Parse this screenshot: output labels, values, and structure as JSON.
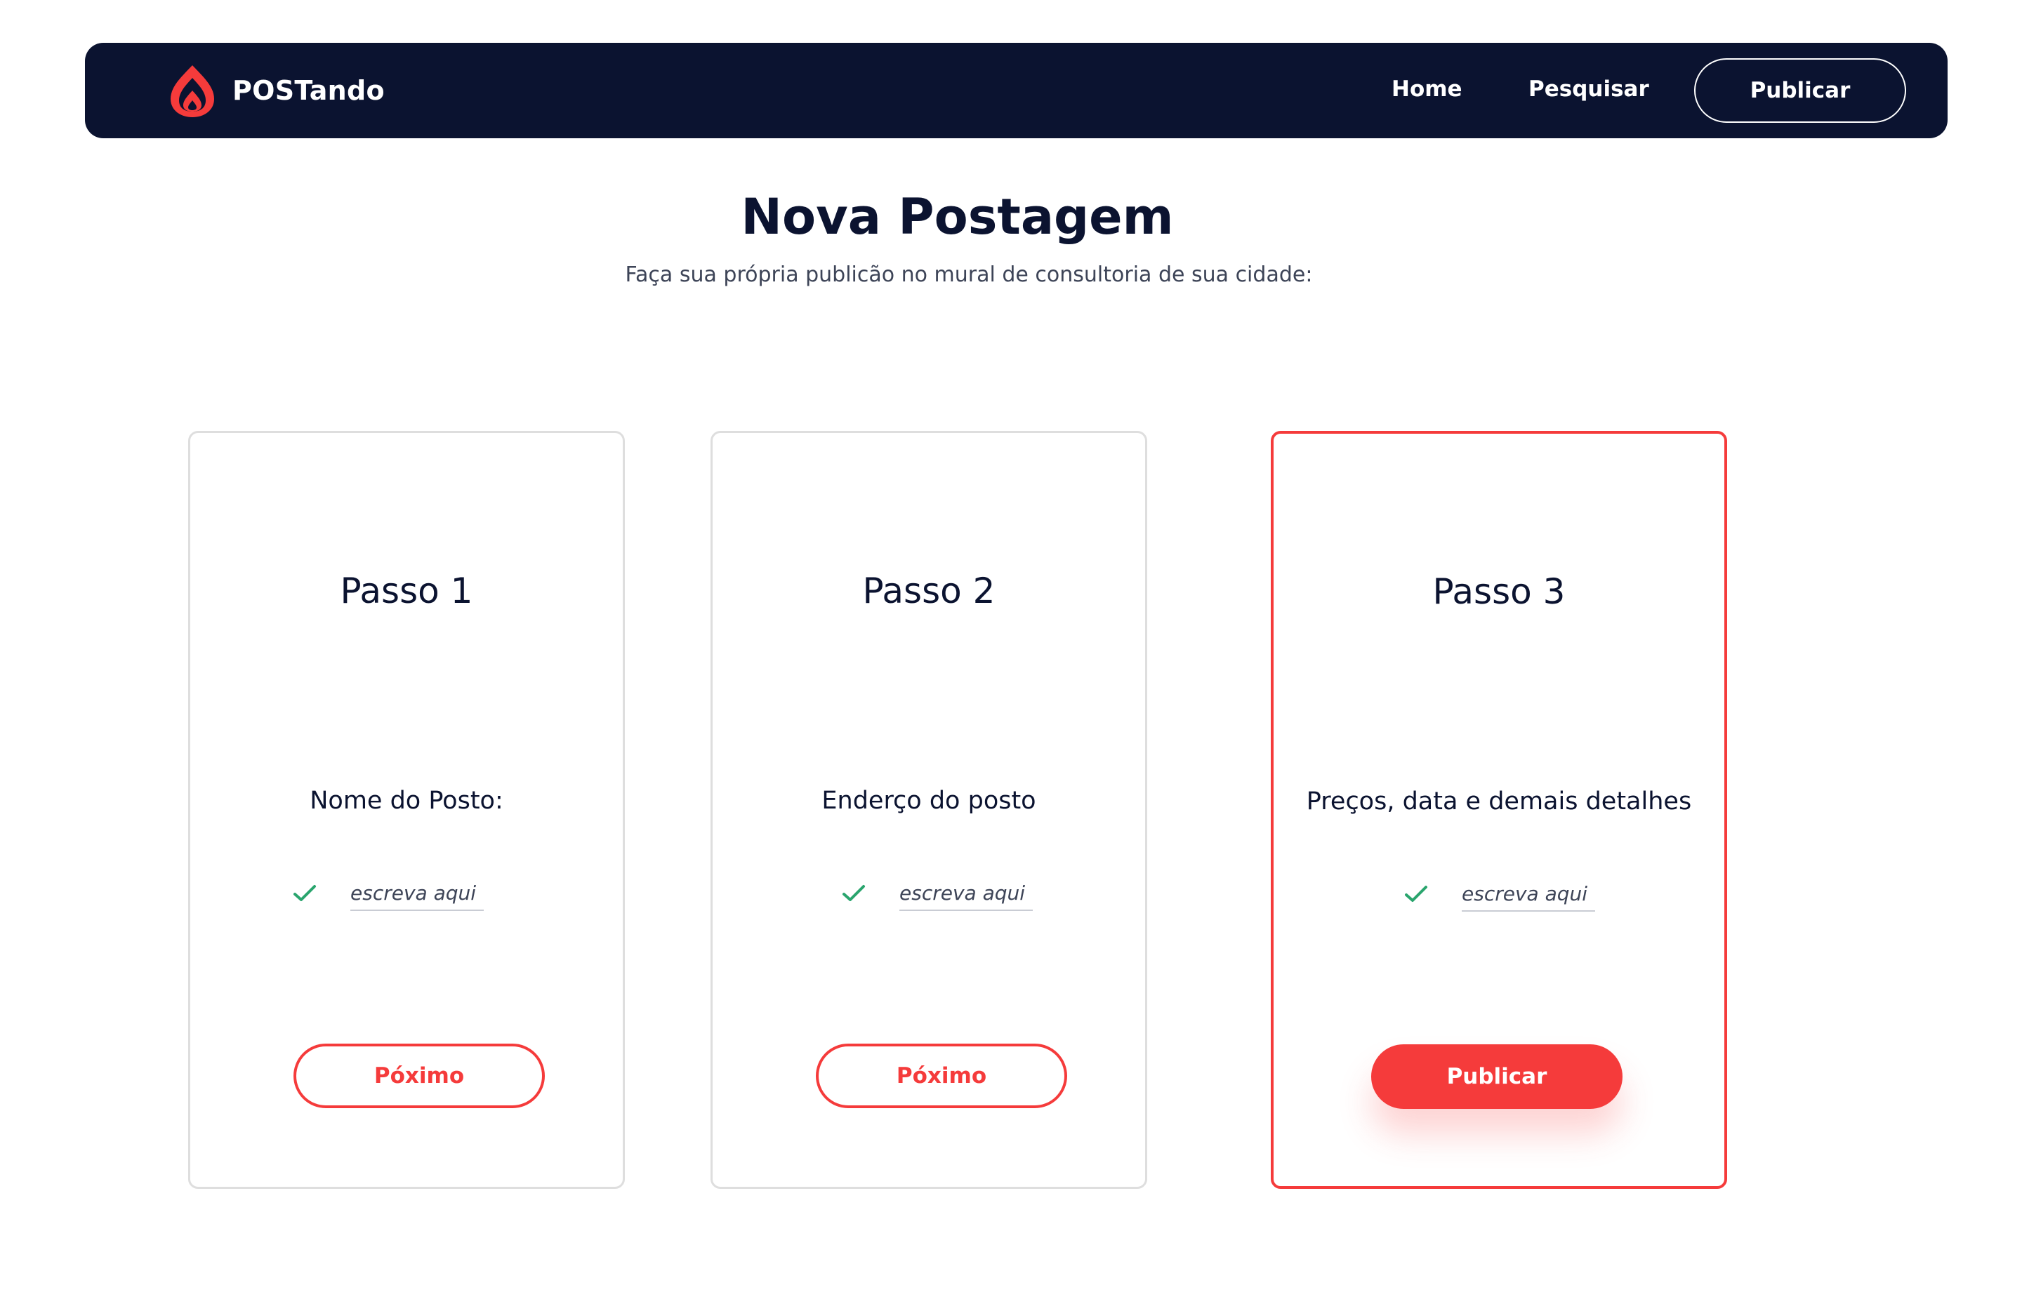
{
  "colors": {
    "navy": "#0b1330",
    "accent": "#f53b3b",
    "check": "#2aa56e",
    "card_border": "#dedede"
  },
  "header": {
    "brand_name": "POSTando",
    "logo_icon": "flame-drop-icon",
    "nav": {
      "home": "Home",
      "search": "Pesquisar",
      "publish": "Publicar"
    }
  },
  "main": {
    "title": "Nova Postagem",
    "subtitle": "Faça sua própria publicão no mural de consultoria de sua cidade:"
  },
  "steps": [
    {
      "title": "Passo 1",
      "label": "Nome do Posto:",
      "placeholder": "escreva aqui |",
      "value": "",
      "button": "Póximo",
      "active": false
    },
    {
      "title": "Passo 2",
      "label": "Enderço do posto",
      "placeholder": "escreva aqui |",
      "value": "",
      "button": "Póximo",
      "active": false
    },
    {
      "title": "Passo 3",
      "label": "Preços, data e demais detalhes",
      "placeholder": "escreva aqui |",
      "value": "",
      "button": "Publicar",
      "active": true
    }
  ]
}
